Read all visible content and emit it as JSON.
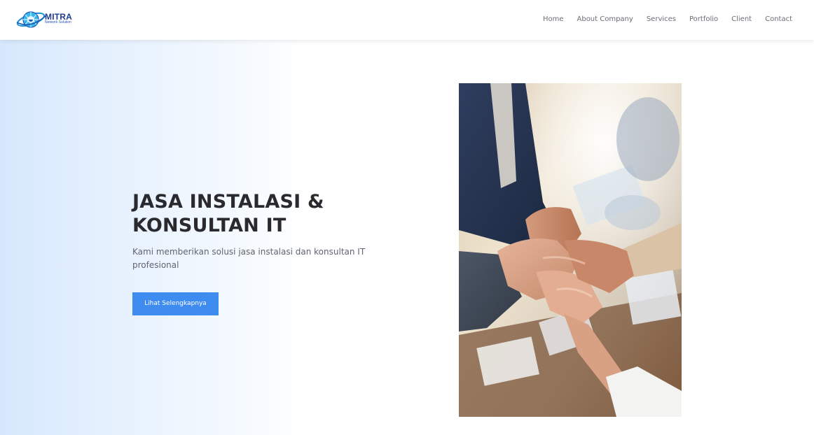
{
  "brand": {
    "name": "MITRA",
    "tagline": "Network Solution",
    "logo_icon": "globe-orbit-icon"
  },
  "nav": {
    "items": [
      {
        "label": "Home"
      },
      {
        "label": "About Company"
      },
      {
        "label": "Services"
      },
      {
        "label": "Portfolio"
      },
      {
        "label": "Client"
      },
      {
        "label": "Contact"
      }
    ]
  },
  "hero": {
    "title": "JASA INSTALASI & KONSULTAN IT",
    "description": "Kami memberikan solusi jasa instalasi dan konsultan IT profesional",
    "cta_label": "Lihat Selengkapnya",
    "image_subject": "team-hands-stacked-photo"
  },
  "colors": {
    "accent": "#3f8cf0",
    "title": "#2a2a2e",
    "nav_text": "#6a6e75",
    "hero_gradient_start": "#d6e8fd"
  }
}
